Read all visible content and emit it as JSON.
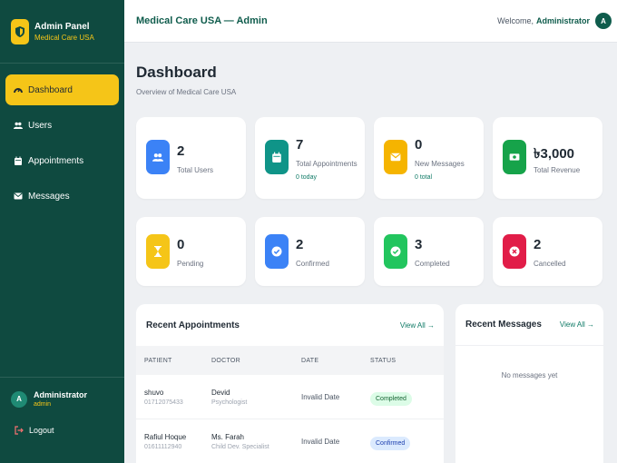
{
  "sidebar": {
    "brand_title": "Admin Panel",
    "brand_sub": "Medical Care USA",
    "items": [
      {
        "label": "Dashboard",
        "icon": "dashboard-icon",
        "active": true
      },
      {
        "label": "Users",
        "icon": "users-icon"
      },
      {
        "label": "Appointments",
        "icon": "calendar-icon"
      },
      {
        "label": "Messages",
        "icon": "envelope-icon"
      }
    ],
    "user": {
      "initial": "A",
      "name": "Administrator",
      "role": "admin"
    },
    "logout": "Logout"
  },
  "topbar": {
    "title": "Medical Care USA — Admin",
    "welcome": "Welcome,",
    "user": "Administrator",
    "initial": "A"
  },
  "page": {
    "title": "Dashboard",
    "subtitle": "Overview of Medical Care USA"
  },
  "stats": [
    {
      "value": "2",
      "label": "Total Users",
      "color": "#3b82f6",
      "icon": "users-icon"
    },
    {
      "value": "7",
      "label": "Total Appointments",
      "sub": "0 today",
      "color": "#0f9488",
      "icon": "calendar-icon"
    },
    {
      "value": "0",
      "label": "New Messages",
      "sub": "0 total",
      "color": "#f5b400",
      "icon": "envelope-icon"
    },
    {
      "value": "৳3,000",
      "label": "Total Revenue",
      "color": "#16a34a",
      "icon": "money-icon"
    },
    {
      "value": "0",
      "label": "Pending",
      "color": "#f5c518",
      "icon": "hourglass-icon"
    },
    {
      "value": "2",
      "label": "Confirmed",
      "color": "#3b82f6",
      "icon": "check-circle-icon"
    },
    {
      "value": "3",
      "label": "Completed",
      "color": "#22c55e",
      "icon": "check-circle-icon"
    },
    {
      "value": "2",
      "label": "Cancelled",
      "color": "#e11d48",
      "icon": "x-circle-icon"
    }
  ],
  "appointments": {
    "title": "Recent Appointments",
    "view_all": "View All →",
    "columns": [
      "PATIENT",
      "DOCTOR",
      "DATE",
      "STATUS"
    ],
    "rows": [
      {
        "patient": "shuvo",
        "phone": "01712075433",
        "doctor": "Devid",
        "specialty": "Psychologist",
        "date": "Invalid Date",
        "status": "Completed"
      },
      {
        "patient": "Rafiul Hoque",
        "phone": "01611112940",
        "doctor": "Ms. Farah",
        "specialty": "Child Dev. Specialist",
        "date": "Invalid Date",
        "status": "Confirmed"
      }
    ]
  },
  "messages": {
    "title": "Recent Messages",
    "view_all": "View All →",
    "empty": "No messages yet"
  }
}
